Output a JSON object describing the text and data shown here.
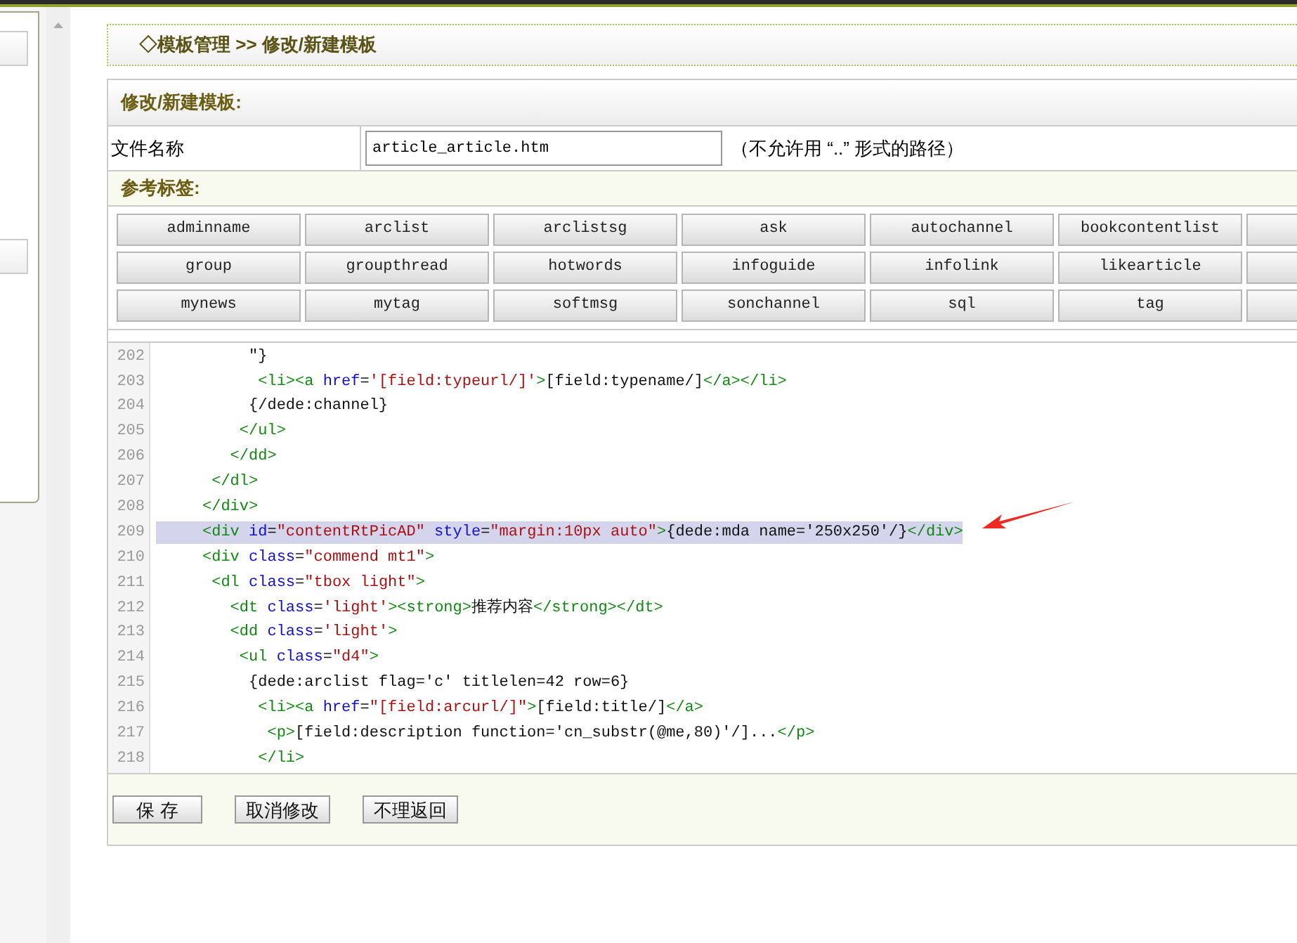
{
  "breadcrumb": "◇模板管理 >> 修改/新建模板",
  "panel_title": "修改/新建模板:",
  "file_field": {
    "label": "文件名称",
    "value": "article_article.htm",
    "hint": "（不允许用 “..” 形式的路径）"
  },
  "reference_title": "参考标签:",
  "tag_buttons": [
    [
      "adminname",
      "arclist",
      "arclistsg",
      "ask",
      "autochannel",
      "bookcontentlist"
    ],
    [
      "group",
      "groupthread",
      "hotwords",
      "infoguide",
      "infolink",
      "likearticle"
    ],
    [
      "mynews",
      "mytag",
      "softmsg",
      "sonchannel",
      "sql",
      "tag"
    ]
  ],
  "code_lines": [
    {
      "number": "202",
      "selected": false,
      "tokens": [
        {
          "kind": "text",
          "text": "          \"}"
        }
      ]
    },
    {
      "number": "203",
      "selected": false,
      "tokens": [
        {
          "kind": "tag",
          "text": "           <li><a "
        },
        {
          "kind": "attr",
          "text": "href"
        },
        {
          "kind": "text",
          "text": "="
        },
        {
          "kind": "value",
          "text": "'[field:typeurl/]'"
        },
        {
          "kind": "tag",
          "text": ">"
        },
        {
          "kind": "text",
          "text": "[field:typename/]"
        },
        {
          "kind": "tag",
          "text": "</a></li>"
        }
      ]
    },
    {
      "number": "204",
      "selected": false,
      "tokens": [
        {
          "kind": "text",
          "text": "          {/dede:channel}"
        }
      ]
    },
    {
      "number": "205",
      "selected": false,
      "tokens": [
        {
          "kind": "tag",
          "text": "         </ul>"
        }
      ]
    },
    {
      "number": "206",
      "selected": false,
      "tokens": [
        {
          "kind": "tag",
          "text": "        </dd>"
        }
      ]
    },
    {
      "number": "207",
      "selected": false,
      "tokens": [
        {
          "kind": "tag",
          "text": "      </dl>"
        }
      ]
    },
    {
      "number": "208",
      "selected": false,
      "tokens": [
        {
          "kind": "tag",
          "text": "     </div>"
        }
      ]
    },
    {
      "number": "209",
      "selected": true,
      "tokens": [
        {
          "kind": "tag",
          "text": "     <div "
        },
        {
          "kind": "attr",
          "text": "id"
        },
        {
          "kind": "text",
          "text": "="
        },
        {
          "kind": "value",
          "text": "\"contentRtPicAD\""
        },
        {
          "kind": "attr",
          "text": " style"
        },
        {
          "kind": "text",
          "text": "="
        },
        {
          "kind": "value",
          "text": "\"margin:10px auto\""
        },
        {
          "kind": "tag",
          "text": ">"
        },
        {
          "kind": "text",
          "text": "{dede:mda name='250x250'/}"
        },
        {
          "kind": "tag",
          "text": "</div>"
        }
      ]
    },
    {
      "number": "210",
      "selected": false,
      "tokens": [
        {
          "kind": "tag",
          "text": "     <div "
        },
        {
          "kind": "attr",
          "text": "class"
        },
        {
          "kind": "text",
          "text": "="
        },
        {
          "kind": "value",
          "text": "\"commend mt1\""
        },
        {
          "kind": "tag",
          "text": ">"
        }
      ]
    },
    {
      "number": "211",
      "selected": false,
      "tokens": [
        {
          "kind": "tag",
          "text": "      <dl "
        },
        {
          "kind": "attr",
          "text": "class"
        },
        {
          "kind": "text",
          "text": "="
        },
        {
          "kind": "value",
          "text": "\"tbox light\""
        },
        {
          "kind": "tag",
          "text": ">"
        }
      ]
    },
    {
      "number": "212",
      "selected": false,
      "tokens": [
        {
          "kind": "tag",
          "text": "        <dt "
        },
        {
          "kind": "attr",
          "text": "class"
        },
        {
          "kind": "text",
          "text": "="
        },
        {
          "kind": "value",
          "text": "'light'"
        },
        {
          "kind": "tag",
          "text": "><strong>"
        },
        {
          "kind": "text",
          "text": "推荐内容"
        },
        {
          "kind": "tag",
          "text": "</strong></dt>"
        }
      ]
    },
    {
      "number": "213",
      "selected": false,
      "tokens": [
        {
          "kind": "tag",
          "text": "        <dd "
        },
        {
          "kind": "attr",
          "text": "class"
        },
        {
          "kind": "text",
          "text": "="
        },
        {
          "kind": "value",
          "text": "'light'"
        },
        {
          "kind": "tag",
          "text": ">"
        }
      ]
    },
    {
      "number": "214",
      "selected": false,
      "tokens": [
        {
          "kind": "tag",
          "text": "         <ul "
        },
        {
          "kind": "attr",
          "text": "class"
        },
        {
          "kind": "text",
          "text": "="
        },
        {
          "kind": "value",
          "text": "\"d4\""
        },
        {
          "kind": "tag",
          "text": ">"
        }
      ]
    },
    {
      "number": "215",
      "selected": false,
      "tokens": [
        {
          "kind": "text",
          "text": "          {dede:arclist flag='c' titlelen=42 row=6}"
        }
      ]
    },
    {
      "number": "216",
      "selected": false,
      "tokens": [
        {
          "kind": "tag",
          "text": "           <li><a "
        },
        {
          "kind": "attr",
          "text": "href"
        },
        {
          "kind": "text",
          "text": "="
        },
        {
          "kind": "value",
          "text": "\"[field:arcurl/]\""
        },
        {
          "kind": "tag",
          "text": ">"
        },
        {
          "kind": "text",
          "text": "[field:title/]"
        },
        {
          "kind": "tag",
          "text": "</a>"
        }
      ]
    },
    {
      "number": "217",
      "selected": false,
      "tokens": [
        {
          "kind": "tag",
          "text": "            <p>"
        },
        {
          "kind": "text",
          "text": "[field:description function='cn_substr(@me,80)'/]..."
        },
        {
          "kind": "tag",
          "text": "</p>"
        }
      ]
    },
    {
      "number": "218",
      "selected": false,
      "tokens": [
        {
          "kind": "tag",
          "text": "           </li>"
        }
      ]
    }
  ],
  "actions": [
    "保 存",
    "取消修改",
    "不理返回"
  ]
}
